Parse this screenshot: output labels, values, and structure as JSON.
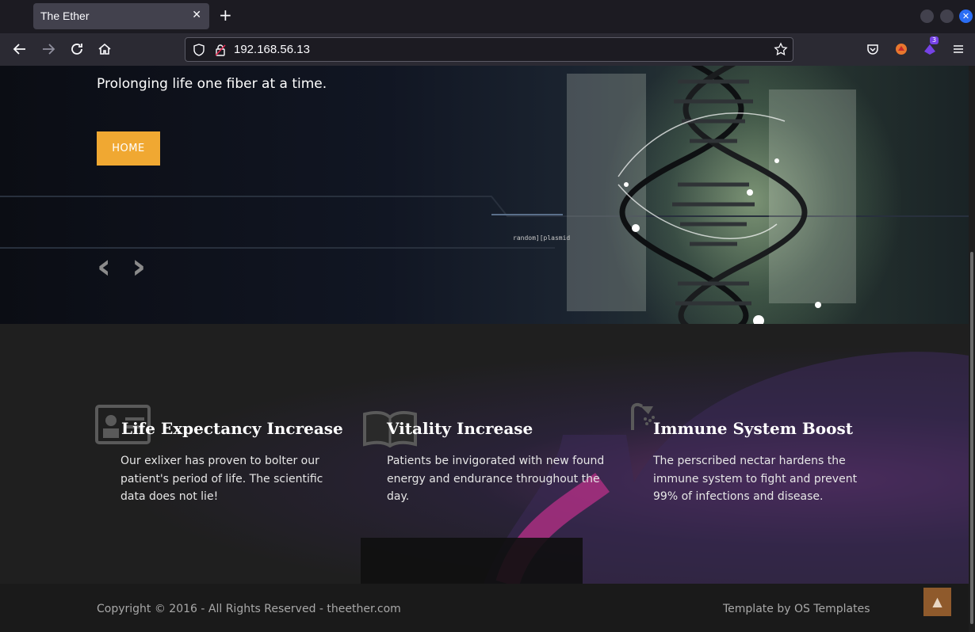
{
  "browser": {
    "tab_title": "The Ether",
    "tab_close": "✕",
    "new_tab": "+",
    "url": "192.168.56.13",
    "extension_badge": "3",
    "icons": [
      "back-icon",
      "forward-icon",
      "reload-icon",
      "home-icon",
      "shield-icon",
      "lock-icon",
      "star-icon",
      "pocket-icon",
      "extension-icon",
      "menu-icon"
    ]
  },
  "hero": {
    "tagline": "Prolonging life one fiber at a time.",
    "button_label": "HOME",
    "caption": "random][plasmid",
    "prev_arrow": "‹",
    "next_arrow": "›"
  },
  "features": [
    {
      "title": "Life Expectancy Increase",
      "text": "Our exlixer has proven to bolter our patient's period of life. The scientific data does not lie!",
      "icon": "id-card-icon"
    },
    {
      "title": "Vitality Increase",
      "text": "Patients be invigorated with new found energy and endurance throughout the day.",
      "icon": "book-icon"
    },
    {
      "title": "Immune System Boost",
      "text": "The perscribed nectar hardens the immune system to fight and prevent 99% of infections and disease.",
      "icon": "shower-icon"
    }
  ],
  "footer": {
    "copyright": "Copyright © 2016 - All Rights Reserved - theether.com",
    "template_credit": "Template by OS Templates",
    "to_top": "▲"
  },
  "colors": {
    "accent": "#f0a832",
    "to_top_button": "#8f5a2c"
  }
}
